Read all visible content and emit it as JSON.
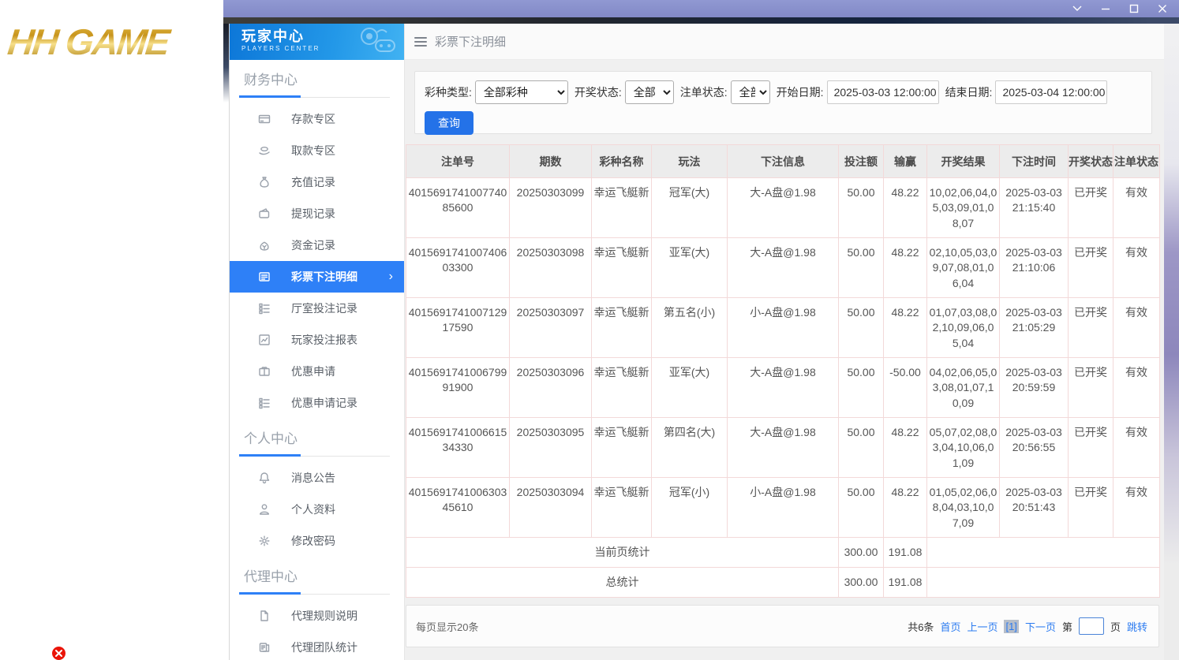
{
  "logo": {
    "text": "HH GAME"
  },
  "window_controls": {
    "dropdown": "chevron-down-icon",
    "minimize": "minimize-icon",
    "maximize": "maximize-icon",
    "close": "close-icon"
  },
  "sidebar": {
    "header": {
      "title": "玩家中心",
      "subtitle": "PLAYERS CENTER",
      "icon": "gamepad-icon"
    },
    "sections": [
      {
        "title": "财务中心",
        "items": [
          {
            "label": "存款专区",
            "icon": "bank-card-icon"
          },
          {
            "label": "取款专区",
            "icon": "hand-withdraw-icon"
          },
          {
            "label": "充值记录",
            "icon": "moneybag-icon"
          },
          {
            "label": "提现记录",
            "icon": "purse-icon"
          },
          {
            "label": "资金记录",
            "icon": "funds-icon"
          },
          {
            "label": "彩票下注明细",
            "icon": "bet-detail-icon",
            "active": true
          },
          {
            "label": "厅室投注记录",
            "icon": "hall-record-icon"
          },
          {
            "label": "玩家投注报表",
            "icon": "report-icon"
          },
          {
            "label": "优惠申请",
            "icon": "promo-icon"
          },
          {
            "label": "优惠申请记录",
            "icon": "promo-record-icon"
          }
        ]
      },
      {
        "title": "个人中心",
        "items": [
          {
            "label": "消息公告",
            "icon": "bell-icon"
          },
          {
            "label": "个人资料",
            "icon": "person-icon"
          },
          {
            "label": "修改密码",
            "icon": "gear-icon"
          }
        ]
      },
      {
        "title": "代理中心",
        "items": [
          {
            "label": "代理规则说明",
            "icon": "doc-icon"
          },
          {
            "label": "代理团队统计",
            "icon": "team-stats-icon"
          }
        ]
      }
    ]
  },
  "topbar": {
    "title": "彩票下注明细"
  },
  "filters": {
    "lottery_type": {
      "label": "彩种类型:",
      "value": "全部彩种"
    },
    "draw_status": {
      "label": "开奖状态:",
      "value": "全部"
    },
    "order_status": {
      "label": "注单状态:",
      "value": "全部"
    },
    "start_date": {
      "label": "开始日期:",
      "value": "2025-03-03 12:00:00"
    },
    "end_date": {
      "label": "结束日期:",
      "value": "2025-03-04 12:00:00"
    },
    "search_label": "查询"
  },
  "table": {
    "headers": [
      "注单号",
      "期数",
      "彩种名称",
      "玩法",
      "下注信息",
      "投注额",
      "输赢",
      "开奖结果",
      "下注时间",
      "开奖状态",
      "注单状态"
    ],
    "rows": [
      [
        "401569174100774085600",
        "20250303099",
        "幸运飞艇新",
        "冠军(大)",
        "大-A盘@1.98",
        "50.00",
        "48.22",
        "10,02,06,04,05,03,09,01,08,07",
        "2025-03-03 21:15:40",
        "已开奖",
        "有效"
      ],
      [
        "401569174100740603300",
        "20250303098",
        "幸运飞艇新",
        "亚军(大)",
        "大-A盘@1.98",
        "50.00",
        "48.22",
        "02,10,05,03,09,07,08,01,06,04",
        "2025-03-03 21:10:06",
        "已开奖",
        "有效"
      ],
      [
        "401569174100712917590",
        "20250303097",
        "幸运飞艇新",
        "第五名(小)",
        "小-A盘@1.98",
        "50.00",
        "48.22",
        "01,07,03,08,02,10,09,06,05,04",
        "2025-03-03 21:05:29",
        "已开奖",
        "有效"
      ],
      [
        "401569174100679991900",
        "20250303096",
        "幸运飞艇新",
        "亚军(大)",
        "大-A盘@1.98",
        "50.00",
        "-50.00",
        "04,02,06,05,03,08,01,07,10,09",
        "2025-03-03 20:59:59",
        "已开奖",
        "有效"
      ],
      [
        "401569174100661534330",
        "20250303095",
        "幸运飞艇新",
        "第四名(大)",
        "大-A盘@1.98",
        "50.00",
        "48.22",
        "05,07,02,08,03,04,10,06,01,09",
        "2025-03-03 20:56:55",
        "已开奖",
        "有效"
      ],
      [
        "401569174100630345610",
        "20250303094",
        "幸运飞艇新",
        "冠军(小)",
        "小-A盘@1.98",
        "50.00",
        "48.22",
        "01,05,02,06,08,04,03,10,07,09",
        "2025-03-03 20:51:43",
        "已开奖",
        "有效"
      ]
    ],
    "summary_rows": [
      {
        "label": "当前页统计",
        "bet_total": "300.00",
        "winloss_total": "191.08"
      },
      {
        "label": "总统计",
        "bet_total": "300.00",
        "winloss_total": "191.08"
      }
    ]
  },
  "pagination": {
    "page_size_text": "每页显示20条",
    "total_text": "共6条",
    "first": "首页",
    "prev": "上一页",
    "current": "[1]",
    "next": "下一页",
    "jump_prefix": "第",
    "jump_suffix": "页",
    "jump_action": "跳转",
    "jump_value": ""
  },
  "colors": {
    "accent_blue": "#2e80f7",
    "query_button": "#2472e8",
    "link_blue": "#2b7bf0",
    "titlebar_purple": "#8a90cb",
    "sidebar_header_blue": "#1c8ce2",
    "table_border_pink": "#f3d9d9",
    "logo_gold": "#c8951d",
    "error_red": "#ea1408"
  }
}
